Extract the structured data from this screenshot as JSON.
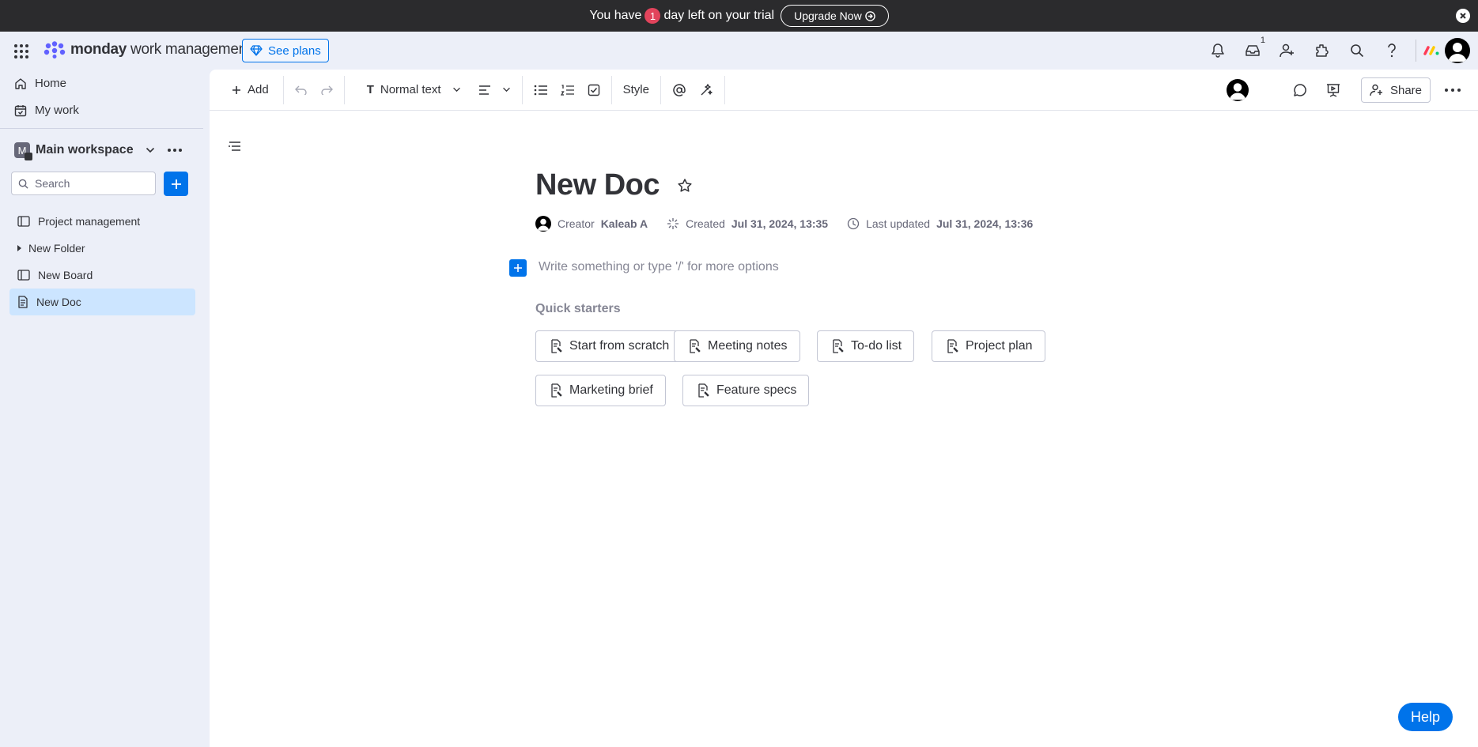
{
  "trial_bar": {
    "text_before": "You have",
    "days": "1",
    "text_after": "day left on your trial",
    "upgrade_label": "Upgrade Now"
  },
  "topnav": {
    "brand_bold": "monday",
    "brand_rest": "work management",
    "see_plans_label": "See plans",
    "inbox_count": "1"
  },
  "sidebar": {
    "home_label": "Home",
    "my_work_label": "My work",
    "workspace_initial": "M",
    "workspace_name": "Main workspace",
    "search_placeholder": "Search",
    "items": [
      {
        "label": "Project management",
        "type": "board"
      },
      {
        "label": "New Folder",
        "type": "folder"
      },
      {
        "label": "New Board",
        "type": "board"
      },
      {
        "label": "New Doc",
        "type": "doc",
        "active": true
      }
    ]
  },
  "toolbar": {
    "add_label": "Add",
    "text_style": "Normal text",
    "style_label": "Style",
    "share_label": "Share"
  },
  "doc": {
    "title": "New Doc",
    "creator_label": "Creator",
    "creator_name": "Kaleab A",
    "created_label": "Created",
    "created_value": "Jul 31, 2024, 13:35",
    "updated_label": "Last updated",
    "updated_value": "Jul 31, 2024, 13:36",
    "placeholder": "Write something or type '/' for more options",
    "quick_starters_label": "Quick starters",
    "quick_starters": [
      "Start from scratch",
      "Meeting notes",
      "To-do list",
      "Project plan",
      "Marketing brief",
      "Feature specs"
    ]
  },
  "help_label": "Help",
  "colors": {
    "accent": "#0073ea",
    "trial_bar_bg": "#2b2b2d",
    "days_badge": "#e2445c",
    "active_item": "#cce5ff"
  }
}
